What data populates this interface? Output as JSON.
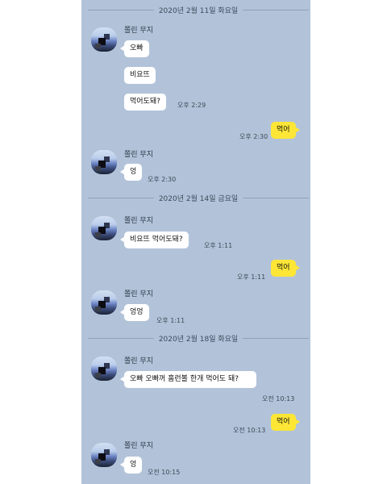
{
  "dates": [
    "2020년 2월 11일 화요일",
    "2020년 2월 14일 금요일",
    "2020년 2월 18일 화요일"
  ],
  "sender_name": "쫄린 무지",
  "day1": {
    "msg1": "오빠",
    "msg2": "비요뜨",
    "msg3": "먹어도돼?",
    "time1": "오후 2:29",
    "reply": "먹어",
    "reply_time": "오후 2:30",
    "answer": "엉",
    "answer_time": "오후 2:30"
  },
  "day2": {
    "msg1": "비요뜨 먹어도돼?",
    "time1": "오후 1:11",
    "reply": "먹어",
    "reply_time": "오후 1:11",
    "answer": "엉엉",
    "answer_time": "오후 1:11"
  },
  "day3": {
    "msg1": "오빠 오빠꺼 홈런볼 한개 먹어도 돼?",
    "time1": "오전 10:13",
    "reply": "먹어",
    "reply_time": "오전 10:13",
    "answer": "엉",
    "answer_time": "오전 10:15"
  },
  "colors": {
    "chat_background": "#b2c3d9",
    "incoming_bubble": "#ffffff",
    "outgoing_bubble": "#fde636"
  }
}
